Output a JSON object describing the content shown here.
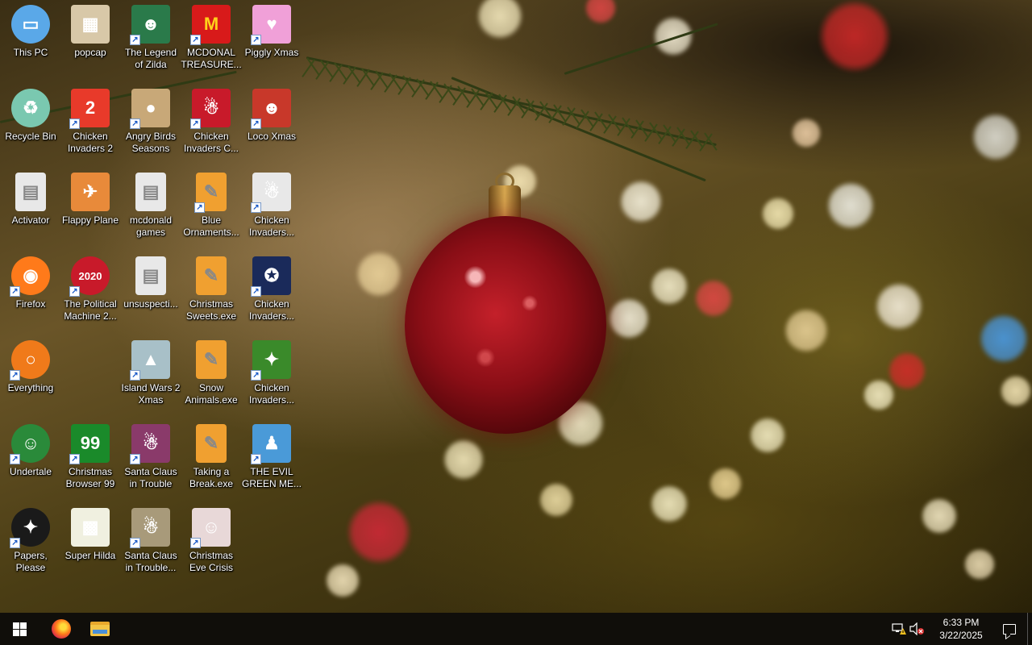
{
  "desktop": {
    "icons": [
      {
        "label": "This PC",
        "icon": "computer-icon",
        "shortcut": false,
        "color": "#5aa8e8",
        "glyph": "▭"
      },
      {
        "label": "Recycle Bin",
        "icon": "recycle-bin-icon",
        "shortcut": false,
        "color": "#7ac8b0",
        "glyph": "♻"
      },
      {
        "label": "Activator",
        "icon": "file-icon",
        "shortcut": false,
        "color": "#e8e8e8",
        "glyph": "▤"
      },
      {
        "label": "Firefox",
        "icon": "firefox-icon",
        "shortcut": true,
        "color": "#ff7a1a",
        "glyph": "◉"
      },
      {
        "label": "Everything",
        "icon": "magnifier-icon",
        "shortcut": true,
        "color": "#f07a1a",
        "glyph": "○"
      },
      {
        "label": "Undertale",
        "icon": "undertale-icon",
        "shortcut": true,
        "color": "#2a8a3a",
        "glyph": "☺"
      },
      {
        "label": "Papers,\nPlease",
        "icon": "papers-please-icon",
        "shortcut": true,
        "color": "#1a1a1a",
        "glyph": "✦"
      },
      {
        "label": "popcap",
        "icon": "folder-icon",
        "shortcut": false,
        "color": "#d8c8a8",
        "glyph": "▦"
      },
      {
        "label": "Chicken\nInvaders 2",
        "icon": "chicken-invaders-2-icon",
        "shortcut": true,
        "color": "#e83a2a",
        "glyph": "2"
      },
      {
        "label": "Flappy Plane",
        "icon": "flappy-plane-icon",
        "shortcut": false,
        "color": "#e88a3a",
        "glyph": "✈"
      },
      {
        "label": "The Political\nMachine 2...",
        "icon": "political-machine-icon",
        "shortcut": true,
        "color": "#c81a2a",
        "glyph": "2020"
      },
      {
        "label": "Christmas\nBrowser 99",
        "icon": "christmas-tree-icon",
        "shortcut": true,
        "color": "#1a8a2a",
        "glyph": "99"
      },
      {
        "label": "Super Hilda",
        "icon": "super-hilda-icon",
        "shortcut": false,
        "color": "#f0f0e0",
        "glyph": "▩"
      },
      {
        "label": "The Legend\nof Zilda",
        "icon": "legend-of-zilda-icon",
        "shortcut": true,
        "color": "#2a7a4a",
        "glyph": "☻"
      },
      {
        "label": "Angry Birds\nSeasons",
        "icon": "angry-birds-icon",
        "shortcut": true,
        "color": "#c8a878",
        "glyph": "●"
      },
      {
        "label": "mcdonald\ngames",
        "icon": "file-icon",
        "shortcut": false,
        "color": "#e8e8e8",
        "glyph": "▤"
      },
      {
        "label": "unsuspecti...",
        "icon": "file-icon",
        "shortcut": false,
        "color": "#e8e8e8",
        "glyph": "▤"
      },
      {
        "label": "Island Wars 2\nXmas",
        "icon": "island-wars-icon",
        "shortcut": true,
        "color": "#a8c0c8",
        "glyph": "▲"
      },
      {
        "label": "Santa Claus\nin Trouble",
        "icon": "santa-claus-icon",
        "shortcut": true,
        "color": "#8a3a6a",
        "glyph": "☃"
      },
      {
        "label": "Santa Claus\nin Trouble...",
        "icon": "santa-claus-icon",
        "shortcut": true,
        "color": "#a89a7a",
        "glyph": "☃"
      },
      {
        "label": "MCDONAL\nTREASURE...",
        "icon": "mcdonalds-icon",
        "shortcut": true,
        "color": "#d81a1a",
        "glyph": "M"
      },
      {
        "label": "Chicken\nInvaders C...",
        "icon": "chicken-invaders-icon",
        "shortcut": true,
        "color": "#c81a2a",
        "glyph": "☃"
      },
      {
        "label": "Blue\nOrnaments...",
        "icon": "installer-icon",
        "shortcut": true,
        "color": "#f0a030",
        "glyph": "✎"
      },
      {
        "label": "Christmas\nSweets.exe",
        "icon": "installer-icon",
        "shortcut": false,
        "color": "#f0a030",
        "glyph": "✎"
      },
      {
        "label": "Snow\nAnimals.exe",
        "icon": "installer-icon",
        "shortcut": false,
        "color": "#f0a030",
        "glyph": "✎"
      },
      {
        "label": "Taking a\nBreak.exe",
        "icon": "installer-icon",
        "shortcut": false,
        "color": "#f0a030",
        "glyph": "✎"
      },
      {
        "label": "Christmas\nEve Crisis",
        "icon": "santa-face-icon",
        "shortcut": true,
        "color": "#e8d8d8",
        "glyph": "☺"
      },
      {
        "label": "Piggly Xmas",
        "icon": "piggly-icon",
        "shortcut": true,
        "color": "#f0a0d8",
        "glyph": "♥"
      },
      {
        "label": "Loco Xmas",
        "icon": "loco-xmas-icon",
        "shortcut": true,
        "color": "#c8382a",
        "glyph": "☻"
      },
      {
        "label": "Chicken\nInvaders...",
        "icon": "chicken-invaders-icon",
        "shortcut": true,
        "color": "#e8e8e8",
        "glyph": "☃"
      },
      {
        "label": "Chicken\nInvaders...",
        "icon": "chicken-invaders-icon",
        "shortcut": true,
        "color": "#1a2a5a",
        "glyph": "✪"
      },
      {
        "label": "Chicken\nInvaders...",
        "icon": "chicken-invaders-icon",
        "shortcut": true,
        "color": "#3a8a2a",
        "glyph": "✦"
      },
      {
        "label": "THE EVIL\nGREEN ME...",
        "icon": "messenger-icon",
        "shortcut": true,
        "color": "#4a9ad8",
        "glyph": "♟"
      }
    ]
  },
  "taskbar": {
    "start": {
      "icon": "windows-logo-icon"
    },
    "pinned": [
      {
        "name": "firefox",
        "icon": "firefox-icon"
      },
      {
        "name": "file-explorer",
        "icon": "folder-icon"
      }
    ],
    "tray": {
      "network_icon": "network-warning-icon",
      "volume_icon": "volume-muted-icon",
      "time": "6:33 PM",
      "date": "3/22/2025",
      "notification_icon": "action-center-icon"
    }
  }
}
